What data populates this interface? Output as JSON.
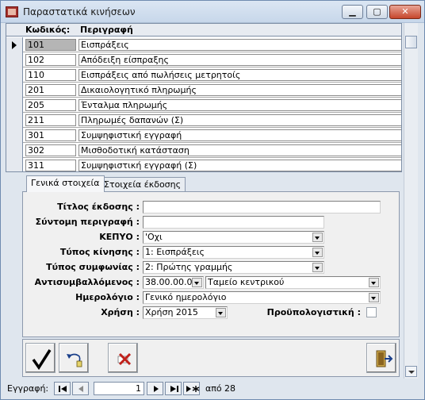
{
  "window": {
    "title": "Παραστατικά κινήσεων",
    "min_label": "▁",
    "max_label": "▢",
    "close_label": "✕"
  },
  "grid": {
    "columns": [
      "Κωδικός:",
      "Περιγραφή"
    ],
    "rows": [
      {
        "code": "101",
        "desc": "Εισπράξεις"
      },
      {
        "code": "102",
        "desc": "Απόδειξη είσπραξης"
      },
      {
        "code": "110",
        "desc": "Εισπράξεις από πωλήσεις μετρητοίς"
      },
      {
        "code": "201",
        "desc": "Δικαιολογητικό πληρωμής"
      },
      {
        "code": "205",
        "desc": "Ένταλμα πληρωμής"
      },
      {
        "code": "211",
        "desc": "Πληρωμές δαπανών (Σ)"
      },
      {
        "code": "301",
        "desc": "Συμψηφιστική εγγραφή"
      },
      {
        "code": "302",
        "desc": "Μισθοδοτική κατάσταση"
      },
      {
        "code": "311",
        "desc": "Συμψηφιστική εγγραφή (Σ)"
      }
    ]
  },
  "tabs": [
    "Γενικά στοιχεία",
    "Στοιχεία έκδοσης"
  ],
  "form": {
    "titlos_label": "Τίτλος έκδοσης :",
    "titlos_value": "",
    "syntomi_label": "Σύντομη περιγραφή :",
    "syntomi_value": "",
    "kepyo_label": "ΚΕΠΥΟ :",
    "kepyo_value": "'Οχι",
    "typos_kinisis_label": "Τύπος κίνησης :",
    "typos_kinisis_value": "1: Εισπράξεις",
    "typos_symfonias_label": "Τύπος συμφωνίας :",
    "typos_symfonias_value": "2: Πρώτης γραμμής",
    "antisymvallomenos_label": "Αντισυμβαλλόμενος :",
    "antisymvallomenos_code": "38.00.00.00",
    "antisymvallomenos_name": "Ταμείο κεντρικού",
    "imerologio_label": "Ημερολόγιο :",
    "imerologio_value": "Γενικό ημερολόγιο",
    "xrisi_label": "Χρήση :",
    "xrisi_value": "Χρήση 2015",
    "proypologistiki_label": "Προϋπολογιστική :"
  },
  "nav": {
    "record_label": "Εγγραφή:",
    "current": "1",
    "of_label": "από",
    "total": "28"
  }
}
